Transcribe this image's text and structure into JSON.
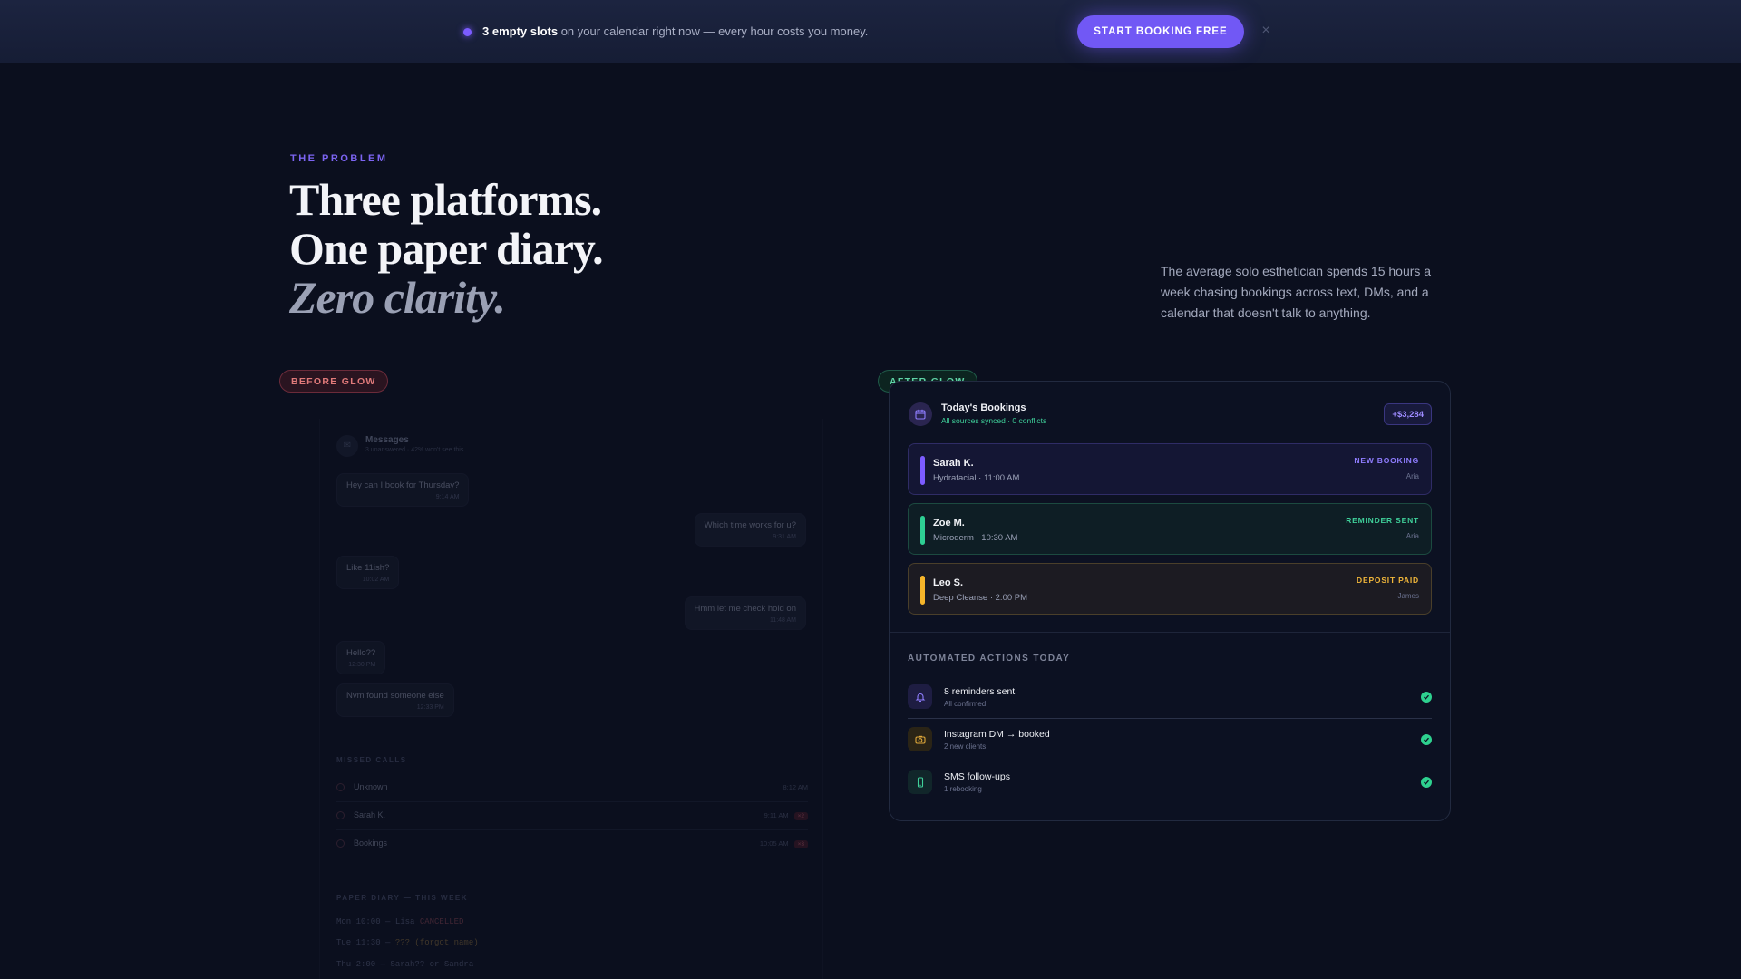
{
  "banner": {
    "highlight": "3 empty slots",
    "text": " on your calendar right now — every hour costs you money.",
    "cta_label": "START BOOKING FREE",
    "close_glyph": "×",
    "accent": "#7158f5"
  },
  "hero": {
    "eyebrow": "THE PROBLEM",
    "headline_lines": [
      "Three platforms.",
      "One paper diary.",
      "Zero clarity."
    ],
    "description": "The average solo esthetician spends 15 hours a week chasing bookings across text, DMs, and a calendar that doesn't talk to anything."
  },
  "before": {
    "pill": "BEFORE GLOW",
    "messages": {
      "title": "Messages",
      "subtitle": "3 unanswered · 42% won't see this",
      "bubbles": [
        {
          "text": "Hey can I book for Thursday?",
          "time": "9:14 AM",
          "side": "left"
        },
        {
          "text": "Which time works for u?",
          "time": "9:31 AM",
          "side": "right"
        },
        {
          "text": "Like 11ish?",
          "time": "10:02 AM",
          "side": "left"
        },
        {
          "text": "Hmm let me check hold on",
          "time": "11:48 AM",
          "side": "right"
        },
        {
          "text": "Hello??",
          "time": "12:30 PM",
          "side": "left"
        },
        {
          "text": "Nvm found someone else",
          "time": "12:33 PM",
          "side": "left"
        }
      ]
    },
    "missed_calls": {
      "label": "MISSED CALLS",
      "rows": [
        {
          "name": "Unknown",
          "time": "8:12 AM",
          "badge": ""
        },
        {
          "name": "Sarah K.",
          "time": "9:11 AM",
          "badge": "×2"
        },
        {
          "name": "Bookings",
          "time": "10:05 AM",
          "badge": "×3"
        }
      ]
    },
    "diary": {
      "label": "PAPER DIARY — THIS WEEK",
      "lines": [
        {
          "prefix": "Mon 10:00 — ",
          "mark": "Lisa",
          "suffix": " CANCELLED"
        },
        {
          "prefix": "Tue 11:30 — ",
          "mark": "??? (forgot name)",
          "suffix": ""
        },
        {
          "prefix": "Thu 2:00 — ",
          "mark": "Sarah?? or Sandra",
          "suffix": ""
        }
      ]
    }
  },
  "after": {
    "pill": "AFTER GLOW",
    "title": "Today's Bookings",
    "subtitle": "All sources synced · 0 conflicts",
    "revenue": "+$3,284",
    "bookings": [
      {
        "name": "Sarah K.",
        "detail": "Hydrafacial · 11:00 AM",
        "status": "NEW BOOKING",
        "staff": "Aria",
        "color": "#7c5cff",
        "status_color": "#8f7dff"
      },
      {
        "name": "Zoe M.",
        "detail": "Microderm · 10:30 AM",
        "status": "REMINDER SENT",
        "staff": "Aria",
        "color": "#2ecf93",
        "status_color": "#3fd09a"
      },
      {
        "name": "Leo S.",
        "detail": "Deep Cleanse · 2:00 PM",
        "status": "DEPOSIT PAID",
        "staff": "James",
        "color": "#f5b52a",
        "status_color": "#f0b63a"
      }
    ],
    "automated_label": "AUTOMATED ACTIONS TODAY",
    "actions": [
      {
        "title": "8 reminders sent",
        "sub": "All confirmed",
        "icon": "bell-icon"
      },
      {
        "title": "Instagram DM → booked",
        "sub": "2 new clients",
        "icon": "camera-icon"
      },
      {
        "title": "SMS follow-ups",
        "sub": "1 rebooking",
        "icon": "phone-icon"
      }
    ]
  }
}
